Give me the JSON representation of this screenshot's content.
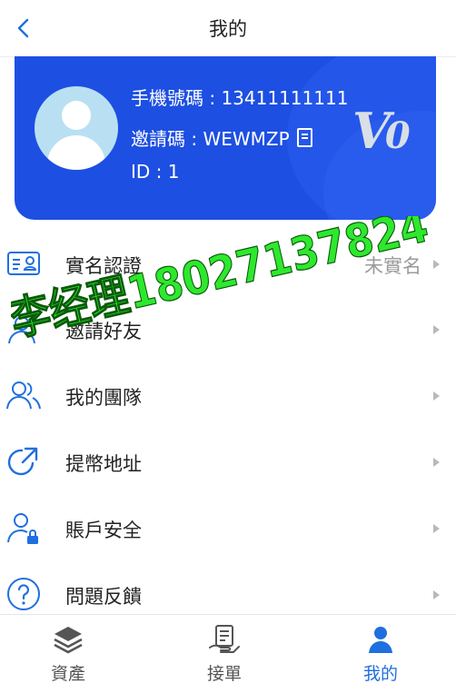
{
  "header": {
    "title": "我的"
  },
  "profile": {
    "phone": "手機號碼 : 13411111111",
    "invite_code": "邀請碼 : WEWMZP",
    "id": "ID : 1",
    "vip_badge": "V",
    "vip_level": "0"
  },
  "menu": [
    {
      "label": "實名認證",
      "value": "未實名",
      "icon": "id-card-icon"
    },
    {
      "label": "邀請好友",
      "value": "",
      "icon": "user-add-icon"
    },
    {
      "label": "我的團隊",
      "value": "",
      "icon": "team-icon"
    },
    {
      "label": "提幣地址",
      "value": "",
      "icon": "share-arrow-icon"
    },
    {
      "label": "賬戶安全",
      "value": "",
      "icon": "user-lock-icon"
    },
    {
      "label": "問題反饋",
      "value": "",
      "icon": "question-icon"
    }
  ],
  "tabs": [
    {
      "label": "資產",
      "icon": "layers-icon",
      "active": false
    },
    {
      "label": "接單",
      "icon": "order-icon",
      "active": false
    },
    {
      "label": "我的",
      "icon": "user-icon",
      "active": true
    }
  ],
  "watermark": {
    "text": "李经理18027137824"
  },
  "colors": {
    "brand": "#1d4fe2",
    "accent": "#1f6fe0",
    "watermark": "#2ee82e"
  }
}
